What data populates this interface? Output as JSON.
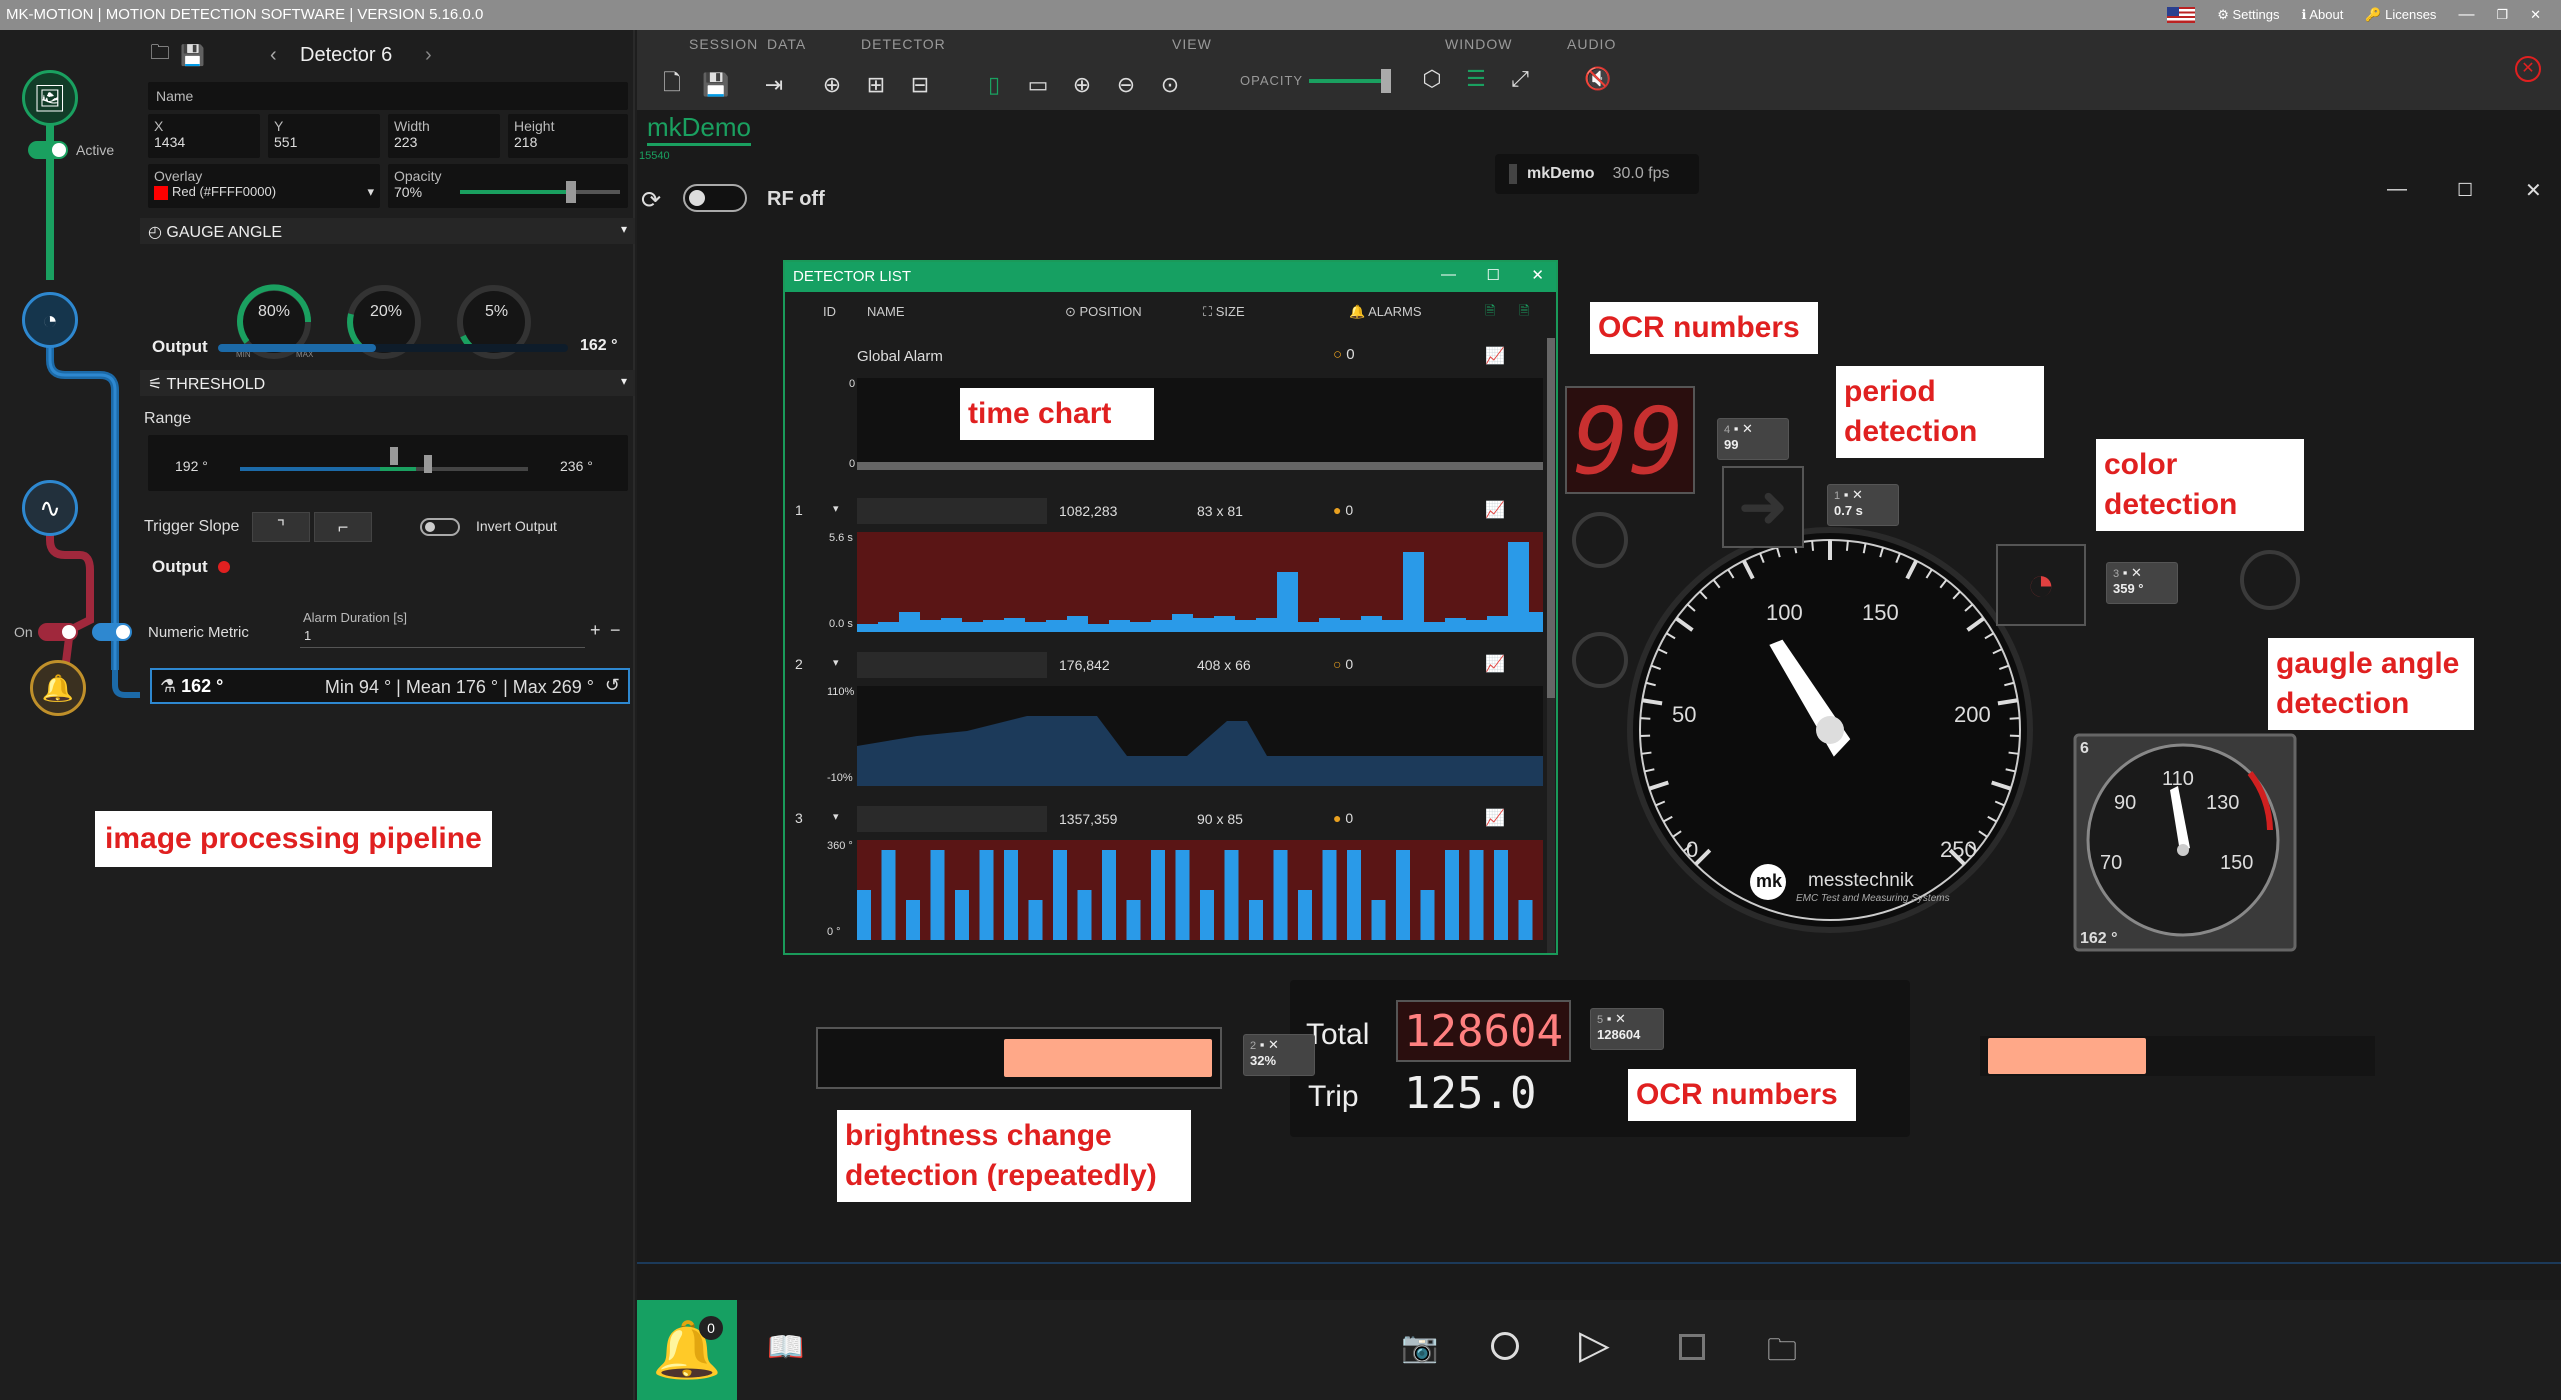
{
  "title": "MK-MOTION | MOTION DETECTION SOFTWARE | VERSION 5.16.0.0",
  "topright": {
    "settings": "Settings",
    "about": "About",
    "licenses": "Licenses"
  },
  "left": {
    "detector": "Detector 6",
    "name_label": "Name",
    "active": "Active",
    "x_label": "X",
    "x_val": "1434",
    "y_label": "Y",
    "y_val": "551",
    "w_label": "Width",
    "w_val": "223",
    "h_label": "Height",
    "h_val": "218",
    "overlay_label": "Overlay",
    "overlay_val": "Red (#FFFF0000)",
    "opacity_label": "Opacity",
    "opacity_val": "70%",
    "gauge_hdr": "GAUGE ANGLE",
    "g1": "80%",
    "g2": "20%",
    "g3": "5%",
    "min": "MIN",
    "max": "MAX",
    "output_label": "Output",
    "output_val": "162 °",
    "output_fill": 0.45,
    "threshold_hdr": "THRESHOLD",
    "range_label": "Range",
    "range_lo": "192 °",
    "range_hi": "236 °",
    "trigger_slope": "Trigger Slope",
    "invert": "Invert Output",
    "output2": "Output",
    "on": "On",
    "numeric": "Numeric Metric",
    "alarm_dur_label": "Alarm Duration [s]",
    "alarm_dur_val": "1",
    "stat_val": "162 °",
    "stat_summary": "Min 94 ° | Mean 176 ° | Max 269 °",
    "pipeline_label": "image processing pipeline"
  },
  "toolbar": {
    "session": "SESSION",
    "data": "DATA",
    "detector": "DETECTOR",
    "view": "VIEW",
    "opacity": "OPACITY",
    "window": "WINDOW",
    "audio": "AUDIO"
  },
  "tab": {
    "name": "mkDemo",
    "counter": "15540",
    "rf": "RF off",
    "cam": "mkDemo",
    "fps": "30.0 fps"
  },
  "dl": {
    "title": "DETECTOR LIST",
    "id": "ID",
    "name": "NAME",
    "position": "POSITION",
    "size": "SIZE",
    "alarms": "ALARMS",
    "global": "Global Alarm",
    "global_alarms": "0",
    "g_top": "0",
    "g_bot": "0",
    "rows": [
      {
        "id": "1",
        "pos": "1082,283",
        "size": "83 x 81",
        "alarms": "0",
        "ytop": "5.6 s",
        "ybot": "0.0 s"
      },
      {
        "id": "2",
        "pos": "176,842",
        "size": "408 x 66",
        "alarms": "0",
        "ytop": "110%",
        "ybot": "-10%"
      },
      {
        "id": "3",
        "pos": "1357,359",
        "size": "90 x 85",
        "alarms": "0",
        "ytop": "360 °",
        "ybot": "0 °"
      }
    ]
  },
  "labels": {
    "time_chart": "time chart",
    "ocr1": "OCR numbers",
    "period": "period detection",
    "color": "color detection",
    "gauge": "gaugle angle detection",
    "bright": "brightness change detection (repeatedly)",
    "ocr2": "OCR numbers"
  },
  "badges": {
    "b4id": "4",
    "b4": "99",
    "b1id": "1",
    "b1": "0.7 s",
    "b3id": "3",
    "b3": "359 °",
    "b2id": "2",
    "b2": "32%",
    "b5id": "5",
    "b5": "128604"
  },
  "dash": {
    "digits": "99",
    "total_label": "Total",
    "total": "128604",
    "trip_label": "Trip",
    "trip": "125.0",
    "g_ticks": [
      "0",
      "50",
      "100",
      "150",
      "200",
      "250"
    ],
    "brand": "messtechnik",
    "brand_sub": "EMC Test and Measuring Systems",
    "mk": "mk",
    "small_id": "6",
    "small_ticks": [
      "70",
      "90",
      "110",
      "130",
      "150"
    ],
    "small_val": "162 °"
  },
  "bottom": {
    "bell_count": "0"
  }
}
